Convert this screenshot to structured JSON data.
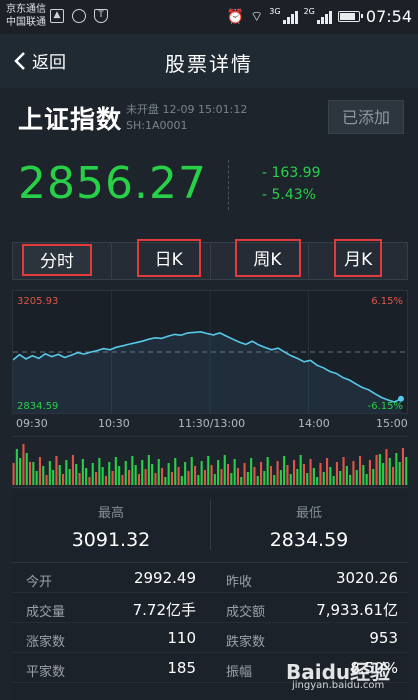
{
  "status_bar": {
    "carrier_line1": "京东通信",
    "carrier_line2": "中国联通",
    "net1": "3G",
    "net2": "2G",
    "time": "07:54"
  },
  "nav": {
    "back_label": "返回",
    "title": "股票详情"
  },
  "stock": {
    "name": "上证指数",
    "status": "未开盘 12-09 15:01:12",
    "code": "SH:1A0001",
    "added_label": "已添加",
    "price": "2856.27",
    "change": "- 163.99",
    "change_pct": "- 5.43%"
  },
  "tabs": [
    "分时",
    "日K",
    "周K",
    "月K"
  ],
  "chart": {
    "y_high": "3205.93",
    "y_low": "2834.59",
    "pct_high": "6.15%",
    "pct_low": "-6.15%",
    "times": [
      "09:30",
      "10:30",
      "11:30/13:00",
      "14:00",
      "15:00"
    ]
  },
  "chart_data": {
    "type": "line",
    "title": "",
    "x": [
      "09:30",
      "10:30",
      "11:30/13:00",
      "14:00",
      "15:00"
    ],
    "ylim": [
      2834.59,
      3205.93
    ],
    "y_right_labels": [
      "6.15%",
      "-6.15%"
    ],
    "reference_line": 3020.26,
    "series": [
      {
        "values": [
          2992.5,
          3011,
          2996,
          3007,
          2998,
          3014,
          3004,
          3012,
          3001,
          3009,
          3018,
          3013,
          3020,
          3025,
          3032,
          3028,
          3037,
          3042,
          3048,
          3053,
          3058,
          3065,
          3070,
          3068,
          3076,
          3082,
          3079,
          3087,
          3089,
          3091,
          3085,
          3080,
          3087,
          3076,
          3065,
          3055,
          3047,
          3058,
          3045,
          3036,
          3028,
          3034,
          3020,
          3007,
          2998,
          2986,
          2991,
          2974,
          2965,
          2952,
          2945,
          2931,
          2922,
          2909,
          2896,
          2888,
          2874,
          2861,
          2852,
          2845,
          2856.27
        ]
      }
    ],
    "volume_bars": 120
  },
  "stats": {
    "high_label": "最高",
    "high_value": "3091.32",
    "low_label": "最低",
    "low_value": "2834.59",
    "rows": [
      {
        "k1": "今开",
        "v1": "2992.49",
        "k2": "昨收",
        "v2": "3020.26"
      },
      {
        "k1": "成交量",
        "v1": "7.72亿手",
        "k2": "成交额",
        "v2": "7,933.61亿"
      },
      {
        "k1": "涨家数",
        "v1": "110",
        "k2": "跌家数",
        "v2": "953"
      },
      {
        "k1": "平家数",
        "v1": "185",
        "k2": "振幅",
        "v2": "8.50%"
      }
    ]
  },
  "watermark": {
    "text": "Baidu经验",
    "url": "jingyan.baidu.com"
  },
  "colors": {
    "down": "#28d048",
    "up": "#e05548",
    "line": "#56c8e8",
    "highlight_box": "#e23b3b"
  }
}
